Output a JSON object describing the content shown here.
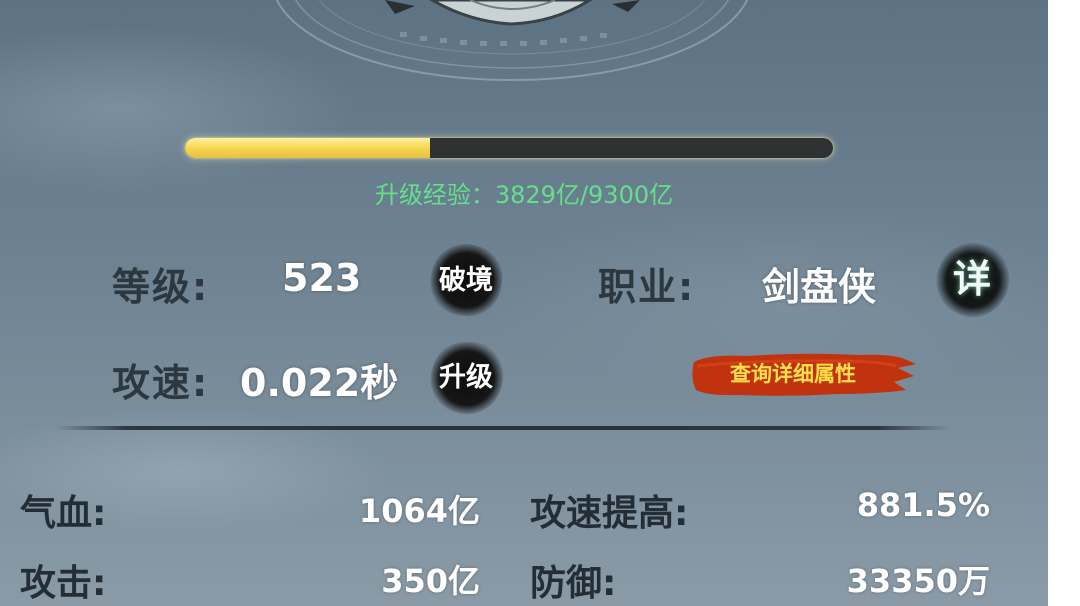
{
  "progress": {
    "fraction": 0.3782,
    "label": "升级经验：",
    "value": "3829亿/9300亿"
  },
  "profile": {
    "level_label": "等级:",
    "level_value": "523",
    "breakthrough_button": "破境",
    "class_label": "职业:",
    "class_value": "剑盘侠",
    "detail_button": "详",
    "attack_speed_label": "攻速:",
    "attack_speed_value": "0.022秒",
    "upgrade_button": "升级",
    "query_button": "查询详细属性"
  },
  "stats": {
    "hp_label": "气血:",
    "hp_value": "1064亿",
    "attack_speed_bonus_label": "攻速提高:",
    "attack_speed_bonus_value": "881.5%",
    "attack_label": "攻击:",
    "attack_value": "350亿",
    "defense_label": "防御:",
    "defense_value": "33350万"
  },
  "colors": {
    "exp_text": "#64e08a",
    "progress_fill": "#f5d957",
    "query_button_bg": "#c0330e",
    "query_button_text": "#ffe04a"
  },
  "icons": {
    "top_emblem": "magic-circle-emblem"
  }
}
